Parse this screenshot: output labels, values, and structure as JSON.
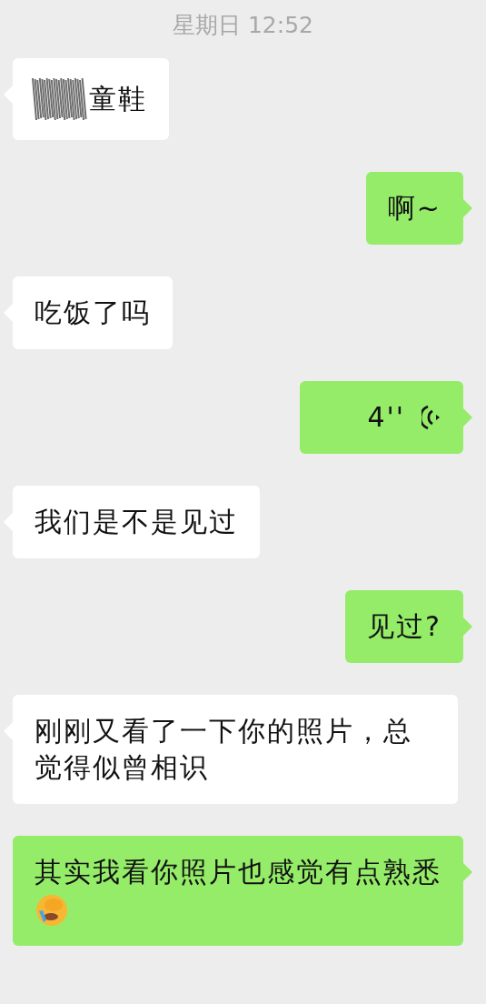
{
  "timestamp": "星期日 12:52",
  "messages": [
    {
      "kind": "text",
      "outgoing": false,
      "redacted": true,
      "text": "童鞋"
    },
    {
      "kind": "text",
      "outgoing": true,
      "redacted": false,
      "text": "啊~"
    },
    {
      "kind": "text",
      "outgoing": false,
      "redacted": false,
      "text": "吃饭了吗"
    },
    {
      "kind": "voice",
      "outgoing": true,
      "redacted": false,
      "text": "4''"
    },
    {
      "kind": "text",
      "outgoing": false,
      "redacted": false,
      "text": "我们是不是见过"
    },
    {
      "kind": "text",
      "outgoing": true,
      "redacted": false,
      "text": "见过?"
    },
    {
      "kind": "text",
      "outgoing": false,
      "redacted": false,
      "text": "刚刚又看了一下你的照片，总觉得似曾相识"
    },
    {
      "kind": "text",
      "outgoing": true,
      "redacted": false,
      "text": "其实我看你照片也感觉有点熟悉",
      "emoji": true
    }
  ]
}
